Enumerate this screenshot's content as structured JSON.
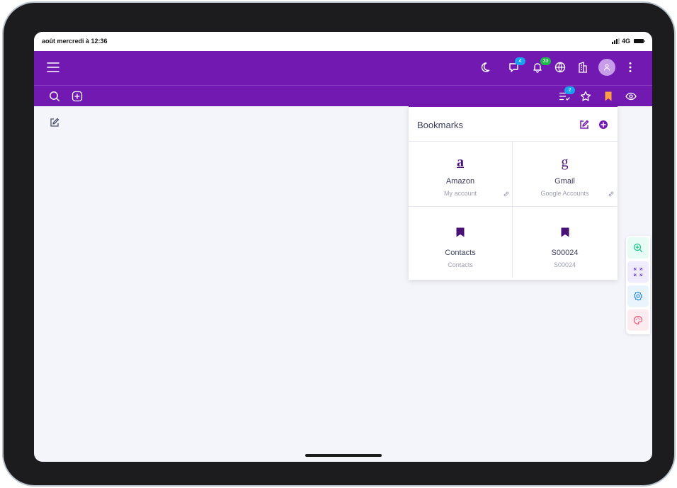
{
  "status_bar": {
    "time": "août mercredi à 12:36",
    "network": "4G"
  },
  "top_bar": {
    "menu_icon": "hamburger-icon",
    "icons": [
      "moon-icon",
      "messages-icon",
      "bell-icon",
      "globe-icon",
      "building-icon",
      "avatar",
      "more-vertical-icon"
    ],
    "messages_badge": "4",
    "notifications_badge": "33"
  },
  "sub_bar": {
    "tasks_badge": "2"
  },
  "colors": {
    "primary": "#7119b0",
    "badge_blue": "#1aa0f0",
    "badge_green": "#1fb84a",
    "bookmark_orange": "#ff9f43"
  },
  "bookmarks": {
    "title": "Bookmarks",
    "items": [
      {
        "icon": "a",
        "name": "Amazon",
        "subtitle": "My account",
        "linked": true
      },
      {
        "icon": "g",
        "name": "Gmail",
        "subtitle": "Google Accounts",
        "linked": true
      },
      {
        "icon": "bookmark-icon",
        "name": "Contacts",
        "subtitle": "Contacts",
        "linked": false
      },
      {
        "icon": "bookmark-icon",
        "name": "S00024",
        "subtitle": "S00024",
        "linked": false
      }
    ]
  },
  "side_tools": [
    "zoom-in-icon",
    "expand-icon",
    "settings-icon",
    "palette-icon"
  ]
}
